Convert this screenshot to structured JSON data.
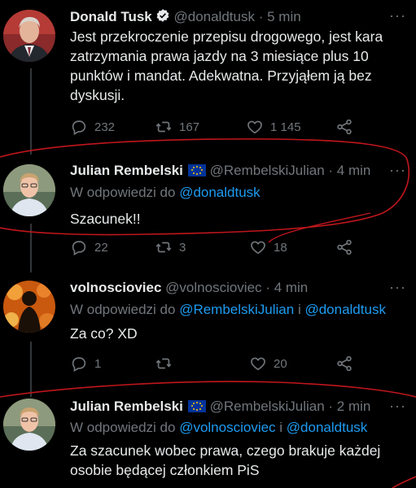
{
  "tweets": [
    {
      "name": "Donald Tusk",
      "handle": "@donaldtusk",
      "time": "5 min",
      "verified": true,
      "text_lines": [
        "Jest przekroczenie przepisu drogowego, jest kara",
        "zatrzymania prawa jazdy na 3 miesiące plus 10",
        "punktów i mandat. Adekwatna. Przyjąłem ją bez",
        "dyskusji."
      ],
      "replies": "232",
      "retweets": "167",
      "likes": "1 145"
    },
    {
      "name": "Julian Rembelski",
      "handle": "@RembelskiJulian",
      "time": "4 min",
      "reply_prefix": "W odpowiedzi do ",
      "reply_to": [
        "@donaldtusk"
      ],
      "text_lines": [
        "Szacunek!!"
      ],
      "replies": "22",
      "retweets": "3",
      "likes": "18"
    },
    {
      "name": "volnoscioviec",
      "handle": "@volnoscioviec",
      "time": "4 min",
      "reply_prefix": "W odpowiedzi do ",
      "reply_to": [
        "@RembelskiJulian",
        "@donaldtusk"
      ],
      "reply_joiner": " i ",
      "text_lines": [
        "Za co? XD"
      ],
      "replies": "1",
      "retweets": "",
      "likes": "20"
    },
    {
      "name": "Julian Rembelski",
      "handle": "@RembelskiJulian",
      "time": "2 min",
      "reply_prefix": "W odpowiedzi do ",
      "reply_to": [
        "@volnoscioviec",
        "@donaldtusk"
      ],
      "reply_joiner": " i ",
      "text_lines": [
        "Za szacunek wobec prawa, czego brakuje każdej",
        "osobie będącej członkiem PiS"
      ]
    }
  ],
  "separator": "·",
  "colors": {
    "background": "#000000",
    "text": "#e7e9ea",
    "secondary": "#71767b",
    "link": "#1d9bf0",
    "annotation": "#c0161c"
  }
}
